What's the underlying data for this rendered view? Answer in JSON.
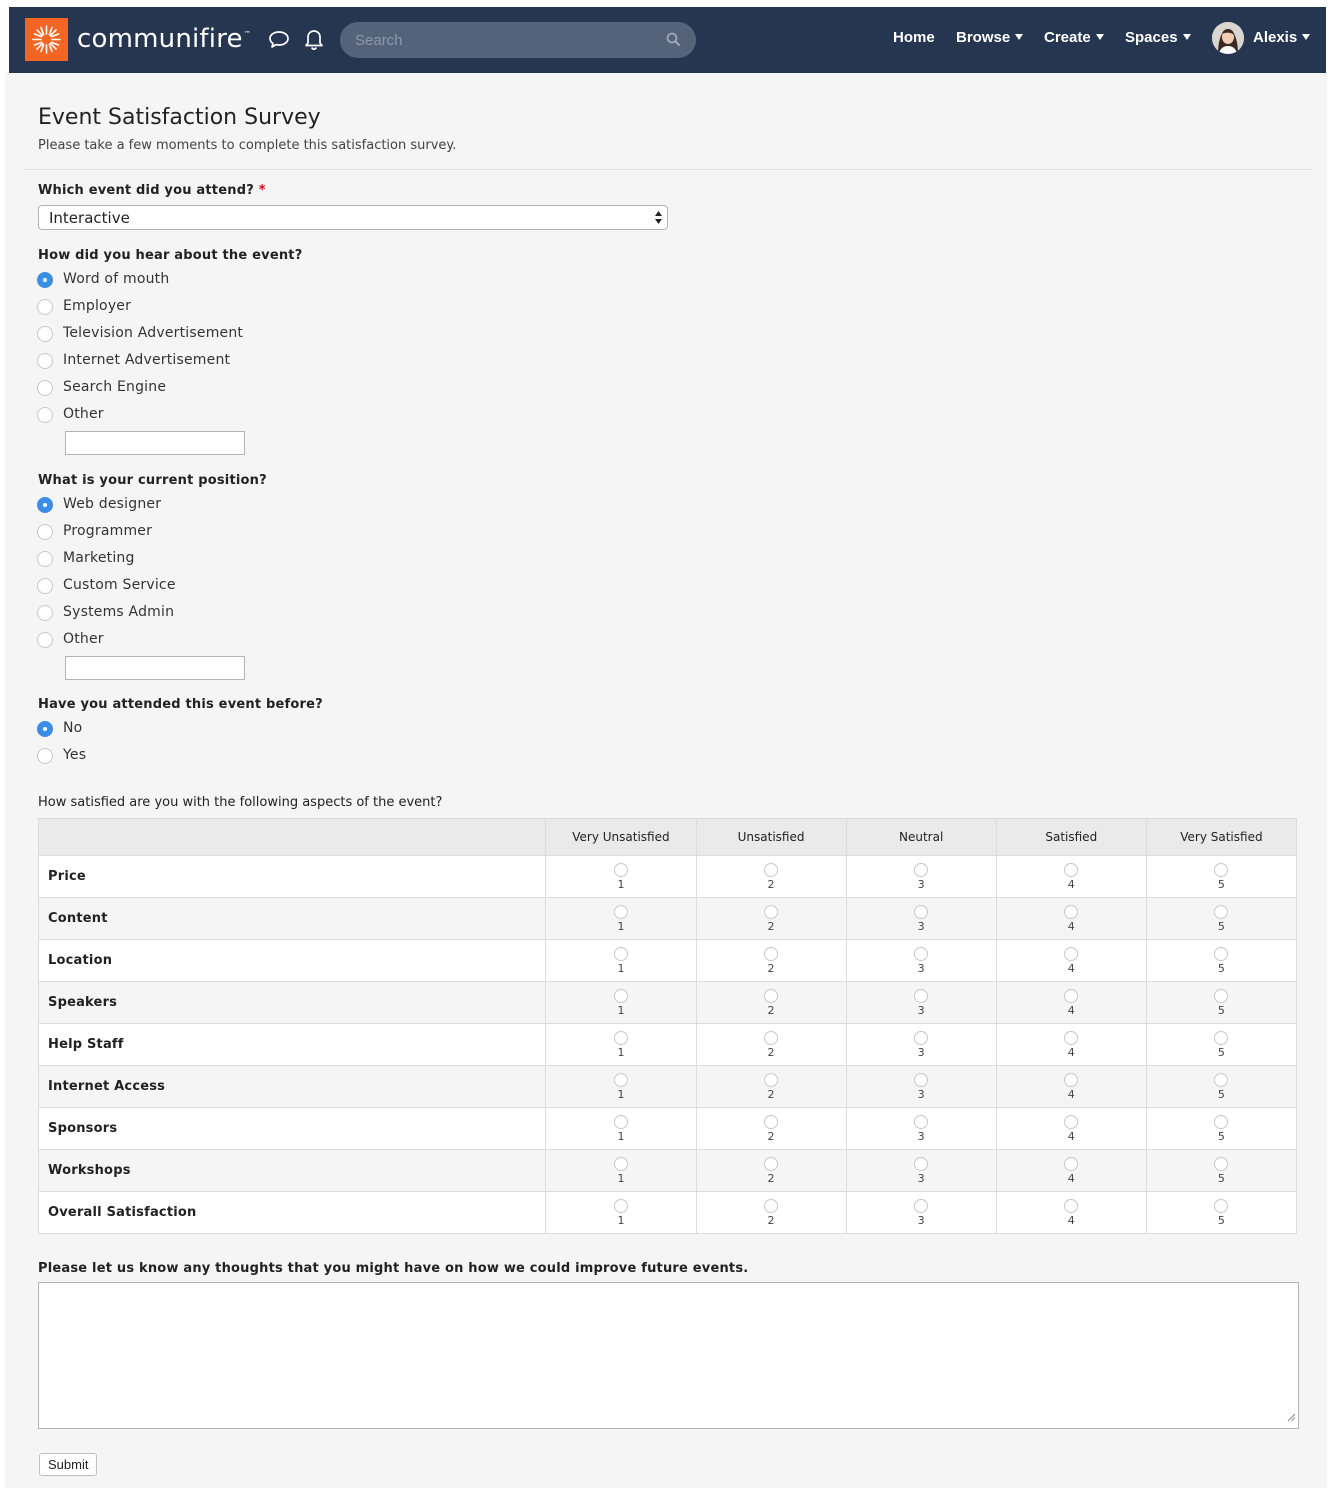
{
  "navbar": {
    "brand": "communifire",
    "brand_tm": "™",
    "search_placeholder": "Search",
    "links": [
      {
        "label": "Home",
        "dropdown": false
      },
      {
        "label": "Browse",
        "dropdown": true
      },
      {
        "label": "Create",
        "dropdown": true
      },
      {
        "label": "Spaces",
        "dropdown": true
      }
    ],
    "user": "Alexis",
    "colors": {
      "bar": "#263651",
      "logo": "#f26522"
    }
  },
  "survey": {
    "title": "Event Satisfaction Survey",
    "subtitle": "Please take a few moments to complete this satisfaction survey.",
    "q1": {
      "label": "Which event did you attend?",
      "required_mark": "*",
      "selected": "Interactive"
    },
    "q2": {
      "label": "How did you hear about the event?",
      "options": [
        "Word of mouth",
        "Employer",
        "Television Advertisement",
        "Internet Advertisement",
        "Search Engine",
        "Other"
      ],
      "selected_index": 0
    },
    "q3": {
      "label": "What is your current position?",
      "options": [
        "Web designer",
        "Programmer",
        "Marketing",
        "Custom Service",
        "Systems Admin",
        "Other"
      ],
      "selected_index": 0
    },
    "q4": {
      "label": "Have you attended this event before?",
      "options": [
        "No",
        "Yes"
      ],
      "selected_index": 0
    },
    "q5": {
      "label": "How satisfied are you with the following aspects of the event?",
      "columns": [
        "Very Unsatisfied",
        "Unsatisfied",
        "Neutral",
        "Satisfied",
        "Very Satisfied"
      ],
      "scale": [
        "1",
        "2",
        "3",
        "4",
        "5"
      ],
      "rows": [
        "Price",
        "Content",
        "Location",
        "Speakers",
        "Help Staff",
        "Internet Access",
        "Sponsors",
        "Workshops",
        "Overall Satisfaction"
      ]
    },
    "q6": {
      "label": "Please let us know any thoughts that you might have on how we could improve future events."
    },
    "submit_label": "Submit",
    "colors": {
      "radio_selected": "#3b8ee5",
      "required": "#d0021b"
    }
  }
}
